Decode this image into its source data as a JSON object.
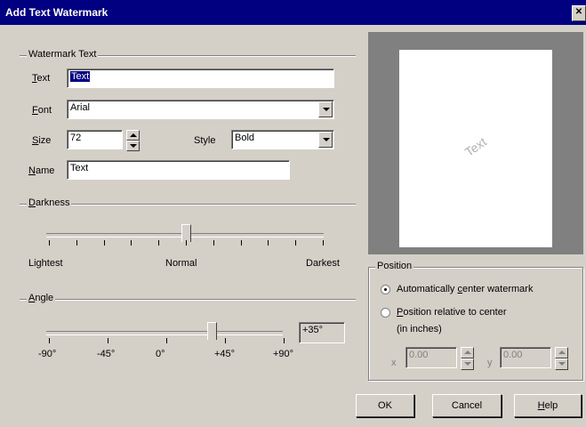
{
  "window": {
    "title": "Add Text Watermark",
    "close_glyph": "✕"
  },
  "watermark_text_group": {
    "label": "Watermark Text",
    "text_label_prefix": "T",
    "text_label_rest": "ext",
    "text_value": "Text",
    "font_label_prefix": "F",
    "font_label_rest": "ont",
    "font_value": "Arial",
    "size_label_prefix": "S",
    "size_label_rest": "ize",
    "size_value": "72",
    "style_label": "Style",
    "style_value": "Bold",
    "name_label_prefix": "N",
    "name_label_rest": "ame",
    "name_value": "Text"
  },
  "darkness": {
    "label_prefix": "D",
    "label_rest": "arkness",
    "min_label": "Lightest",
    "mid_label": "Normal",
    "max_label": "Darkest",
    "level_fraction": 0.5
  },
  "angle": {
    "label_prefix": "A",
    "label_rest": "ngle",
    "ticks": [
      "-90°",
      "-45°",
      "0°",
      "+45°",
      "+90°"
    ],
    "value": "+35°",
    "degrees": 35
  },
  "preview": {
    "watermark_text": "Text"
  },
  "position": {
    "label": "Position",
    "auto_label_a": "Automatically ",
    "auto_label_u": "c",
    "auto_label_b": "enter watermark",
    "relative_label_a": "",
    "relative_label_u": "P",
    "relative_label_b": "osition relative to center",
    "relative_label_sub": "(in inches)",
    "selected": "auto",
    "x_label": "x",
    "x_value": "0.00",
    "y_label": "y",
    "y_value": "0.00"
  },
  "buttons": {
    "ok": "OK",
    "cancel": "Cancel",
    "help_u": "H",
    "help_rest": "elp"
  },
  "colors": {
    "title_bar": "#000080",
    "dialog": "#d4d0c8",
    "preview_bg": "#808080"
  }
}
